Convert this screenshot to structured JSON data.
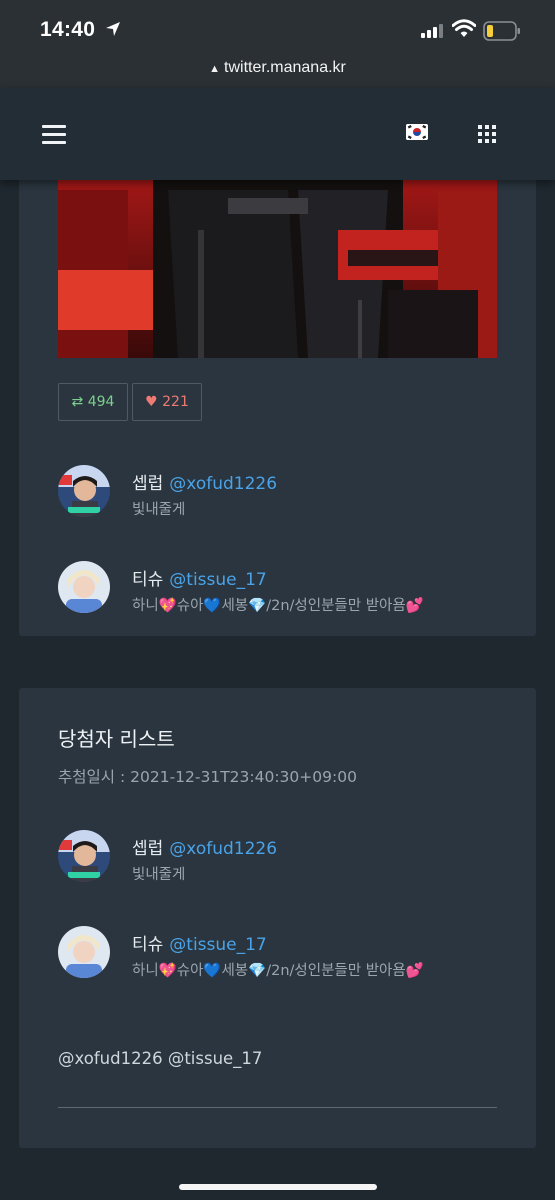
{
  "status": {
    "time": "14:40",
    "url": "twitter.manana.kr"
  },
  "icons": {
    "menu": "hamburger-menu-icon",
    "flag": "korea-flag-icon",
    "apps": "grid-icon"
  },
  "tweet": {
    "retweet_count": "494",
    "like_count": "221",
    "retweet_color": "#7ed08d",
    "like_color": "#ee7b73"
  },
  "participants": [
    {
      "name": "셉럽",
      "handle": "@xofud1226",
      "bio": "빛내줄게"
    },
    {
      "name": "티슈",
      "handle": "@tissue_17",
      "bio": "하니💖슈아💙세봉💎/2n/성인분들만 받아욤💕"
    }
  ],
  "winners": {
    "title": "당첨자 리스트",
    "draw_time": "추첨일시 : 2021-12-31T23:40:30+09:00",
    "list": [
      {
        "name": "셉럽",
        "handle": "@xofud1226",
        "bio": "빛내줄게"
      },
      {
        "name": "티슈",
        "handle": "@tissue_17",
        "bio": "하니💖슈아💙세봉💎/2n/성인분들만 받아욤💕"
      }
    ],
    "mentions": "@xofud1226 @tissue_17"
  },
  "colors": {
    "background": "#1f282f",
    "card": "#2a353f",
    "handle": "#4aa3e8"
  }
}
